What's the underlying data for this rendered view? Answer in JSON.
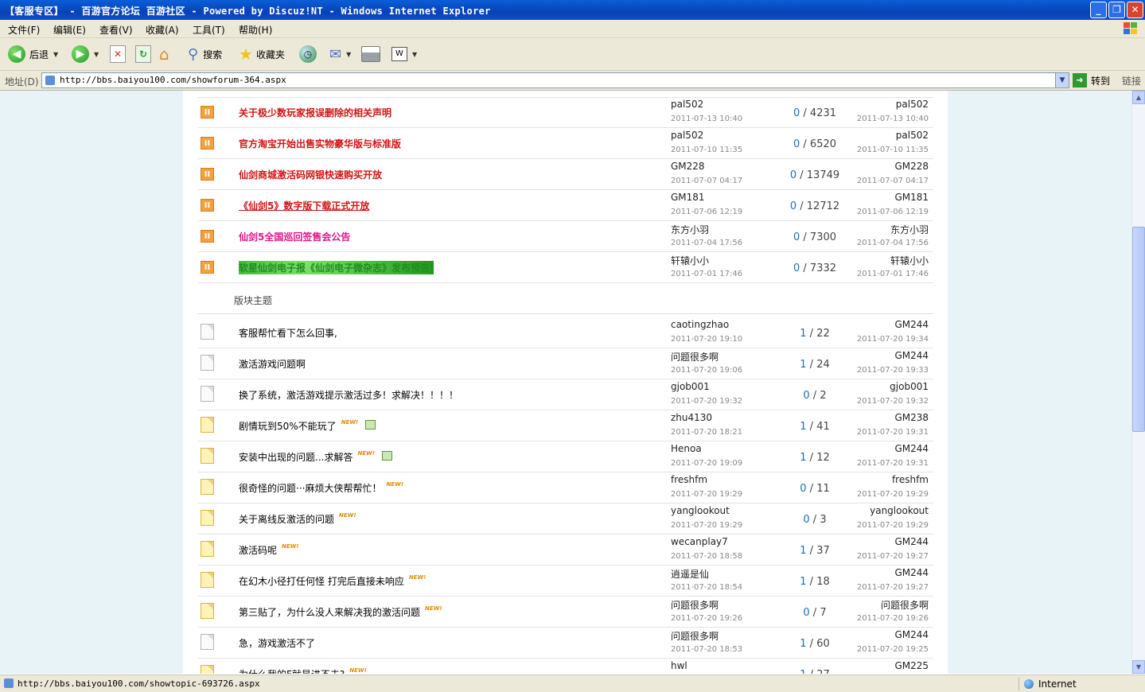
{
  "window": {
    "title": "【客服专区】 - 百游官方论坛 百游社区 - Powered by Discuz!NT - Windows Internet Explorer"
  },
  "menu": [
    "文件(F)",
    "编辑(E)",
    "查看(V)",
    "收藏(A)",
    "工具(T)",
    "帮助(H)"
  ],
  "toolbar": {
    "back_label": "后退",
    "search_label": "搜索",
    "favorites_label": "收藏夹"
  },
  "address": {
    "label": "地址(D)",
    "url": "http://bbs.baiyou100.com/showforum-364.aspx",
    "go_label": "转到",
    "links_label": "链接"
  },
  "colors": {
    "announce_red": "#d31414",
    "announce_pink": "#e0168c",
    "announce_green": "#1e8e1e",
    "reply_blue": "#1d6fb5",
    "page_bg": "#e8f3f8"
  },
  "announcements": [
    {
      "subject": "关于极少数玩家报误删除的相关声明",
      "style": "red",
      "author": "pal502",
      "date": "2011-07-13 10:40",
      "replies": "0",
      "views": "4231",
      "last_user": "pal502",
      "last_date": "2011-07-13 10:40"
    },
    {
      "subject": "官方淘宝开始出售实物豪华版与标准版",
      "style": "red",
      "author": "pal502",
      "date": "2011-07-10 11:35",
      "replies": "0",
      "views": "6520",
      "last_user": "pal502",
      "last_date": "2011-07-10 11:35"
    },
    {
      "subject": "仙剑商城激活码网银快速购买开放",
      "style": "red",
      "author": "GM228",
      "date": "2011-07-07 04:17",
      "replies": "0",
      "views": "13749",
      "last_user": "GM228",
      "last_date": "2011-07-07 04:17"
    },
    {
      "subject": "《仙剑5》数字版下载正式开放",
      "style": "red link",
      "author": "GM181",
      "date": "2011-07-06 12:19",
      "replies": "0",
      "views": "12712",
      "last_user": "GM181",
      "last_date": "2011-07-06 12:19"
    },
    {
      "subject": "仙剑5全国巡回签售会公告",
      "style": "pink",
      "author": "东方小羽",
      "date": "2011-07-04 17:56",
      "replies": "0",
      "views": "7300",
      "last_user": "东方小羽",
      "last_date": "2011-07-04 17:56"
    },
    {
      "subject": "软星仙剑电子报《仙剑电子微杂志》发布预告!",
      "style": "green",
      "author": "轩辕小小",
      "date": "2011-07-01 17:46",
      "replies": "0",
      "views": "7332",
      "last_user": "轩辕小小",
      "last_date": "2011-07-01 17:46"
    }
  ],
  "section_label": "版块主题",
  "topics": [
    {
      "subject": "客服帮忙看下怎么回事,",
      "icon": "doc",
      "new": false,
      "img": false,
      "author": "caotingzhao",
      "date": "2011-07-20 19:10",
      "replies": "1",
      "views": "22",
      "last_user": "GM244",
      "last_date": "2011-07-20 19:34"
    },
    {
      "subject": "激活游戏问题啊",
      "icon": "doc",
      "new": false,
      "img": false,
      "author": "问题很多啊",
      "date": "2011-07-20 19:06",
      "replies": "1",
      "views": "24",
      "last_user": "GM244",
      "last_date": "2011-07-20 19:33"
    },
    {
      "subject": "换了系统，激活游戏提示激活过多！求解决！！！！",
      "icon": "doc",
      "new": false,
      "img": false,
      "author": "gjob001",
      "date": "2011-07-20 19:32",
      "replies": "0",
      "views": "2",
      "last_user": "gjob001",
      "last_date": "2011-07-20 19:32"
    },
    {
      "subject": "剧情玩到50%不能玩了",
      "icon": "hot",
      "new": true,
      "img": true,
      "author": "zhu4130",
      "date": "2011-07-20 18:21",
      "replies": "1",
      "views": "41",
      "last_user": "GM238",
      "last_date": "2011-07-20 19:31"
    },
    {
      "subject": "安装中出现的问题...求解答",
      "icon": "hot",
      "new": true,
      "img": true,
      "author": "Henoa",
      "date": "2011-07-20 19:09",
      "replies": "1",
      "views": "12",
      "last_user": "GM244",
      "last_date": "2011-07-20 19:31"
    },
    {
      "subject": "很奇怪的问题···麻烦大侠帮帮忙！",
      "icon": "hot",
      "new": true,
      "img": false,
      "author": "freshfm",
      "date": "2011-07-20 19:29",
      "replies": "0",
      "views": "11",
      "last_user": "freshfm",
      "last_date": "2011-07-20 19:29"
    },
    {
      "subject": "关于离线反激活的问题",
      "icon": "hot",
      "new": true,
      "img": false,
      "author": "yanglookout",
      "date": "2011-07-20 19:29",
      "replies": "0",
      "views": "3",
      "last_user": "yanglookout",
      "last_date": "2011-07-20 19:29"
    },
    {
      "subject": "激活码呢",
      "icon": "hot",
      "new": true,
      "img": false,
      "author": "wecanplay7",
      "date": "2011-07-20 18:58",
      "replies": "1",
      "views": "37",
      "last_user": "GM244",
      "last_date": "2011-07-20 19:27"
    },
    {
      "subject": "在幻木小径打任何怪 打完后直接未响应",
      "icon": "hot",
      "new": true,
      "img": false,
      "author": "逍遥是仙",
      "date": "2011-07-20 18:54",
      "replies": "1",
      "views": "18",
      "last_user": "GM244",
      "last_date": "2011-07-20 19:27"
    },
    {
      "subject": "第三贴了，为什么没人来解决我的激活问题",
      "icon": "hot",
      "new": true,
      "img": false,
      "author": "问题很多啊",
      "date": "2011-07-20 19:26",
      "replies": "0",
      "views": "7",
      "last_user": "问题很多啊",
      "last_date": "2011-07-20 19:26"
    },
    {
      "subject": "急，游戏激活不了",
      "icon": "doc",
      "new": false,
      "img": false,
      "author": "问题很多啊",
      "date": "2011-07-20 18:53",
      "replies": "1",
      "views": "60",
      "last_user": "GM244",
      "last_date": "2011-07-20 19:25"
    },
    {
      "subject": "为什么我的F就是进不去?",
      "icon": "hot",
      "new": true,
      "img": false,
      "author": "hwl",
      "date": "",
      "replies": "1",
      "views": "27",
      "last_user": "GM225",
      "last_date": ""
    }
  ],
  "new_label": "NEW!",
  "status": {
    "url": "http://bbs.baiyou100.com/showtopic-693726.aspx",
    "zone": "Internet"
  }
}
